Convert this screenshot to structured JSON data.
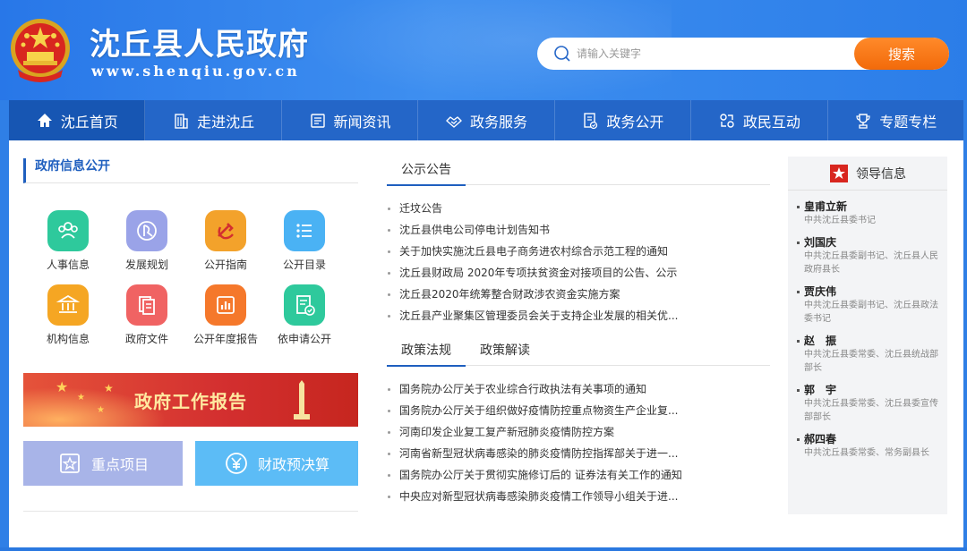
{
  "header": {
    "site_title": "沈丘县人民政府",
    "domain": "www.shenqiu.gov.cn",
    "search_placeholder": "请输入关键字",
    "search_button": "搜索"
  },
  "nav": [
    {
      "label": "沈丘首页",
      "icon": "home-icon",
      "active": true
    },
    {
      "label": "走进沈丘",
      "icon": "building-icon"
    },
    {
      "label": "新闻资讯",
      "icon": "newspaper-icon"
    },
    {
      "label": "政务服务",
      "icon": "handshake-icon"
    },
    {
      "label": "政务公开",
      "icon": "document-check-icon"
    },
    {
      "label": "政民互动",
      "icon": "interaction-icon"
    },
    {
      "label": "专题专栏",
      "icon": "trophy-icon"
    }
  ],
  "gov_info": {
    "title": "政府信息公开",
    "items": [
      {
        "label": "人事信息",
        "icon": "people-icon",
        "color": "#2ec99c"
      },
      {
        "label": "发展规划",
        "icon": "compass-icon",
        "color": "#9aa3e8"
      },
      {
        "label": "公开指南",
        "icon": "party-emblem-icon",
        "color": "#f3a22b"
      },
      {
        "label": "公开目录",
        "icon": "list-icon",
        "color": "#4ab2f4"
      },
      {
        "label": "机构信息",
        "icon": "institution-icon",
        "color": "#f5a623"
      },
      {
        "label": "政府文件",
        "icon": "files-icon",
        "color": "#f06363"
      },
      {
        "label": "公开年度报告",
        "icon": "chart-report-icon",
        "color": "#f5782b"
      },
      {
        "label": "依申请公开",
        "icon": "application-icon",
        "color": "#2ec99c"
      }
    ]
  },
  "report_banner": {
    "label": "政府工作报告"
  },
  "buttons": {
    "key_projects": "重点项目",
    "finance_budget": "财政预决算"
  },
  "notices": {
    "tab": "公示公告",
    "items": [
      "迁坟公告",
      "沈丘县供电公司停电计划告知书",
      "关于加快实施沈丘县电子商务进农村综合示范工程的通知",
      "沈丘县财政局 2020年专项扶贫资金对接项目的公告、公示",
      "沈丘县2020年统筹整合财政涉农资金实施方案",
      "沈丘县产业聚集区管理委员会关于支持企业发展的相关优..."
    ]
  },
  "policy": {
    "tabs": [
      "政策法规",
      "政策解读"
    ],
    "items": [
      "国务院办公厅关于农业综合行政执法有关事项的通知",
      "国务院办公厅关于组织做好疫情防控重点物资生产企业复...",
      "河南印发企业复工复产新冠肺炎疫情防控方案",
      "河南省新型冠状病毒感染的肺炎疫情防控指挥部关于进一...",
      "国务院办公厅关于贯彻实施修订后的 证券法有关工作的通知",
      "中央应对新型冠状病毒感染肺炎疫情工作领导小组关于进..."
    ]
  },
  "leaders": {
    "title": "领导信息",
    "items": [
      {
        "name": "皇甫立新",
        "title": "中共沈丘县委书记"
      },
      {
        "name": "刘国庆",
        "title": "中共沈丘县委副书记、沈丘县人民政府县长"
      },
      {
        "name": "贾庆伟",
        "title": "中共沈丘县委副书记、沈丘县政法委书记"
      },
      {
        "name": "赵　振",
        "title": "中共沈丘县委常委、沈丘县统战部部长"
      },
      {
        "name": "郭　宇",
        "title": "中共沈丘县委常委、沈丘县委宣传部部长"
      },
      {
        "name": "郝四春",
        "title": "中共沈丘县委常委、常务副县长"
      }
    ]
  },
  "colors": {
    "header_blue": "#2f7fe6",
    "nav_blue": "#2466c8",
    "accent_orange": "#f26a0a",
    "title_blue": "#1f5fbf"
  }
}
